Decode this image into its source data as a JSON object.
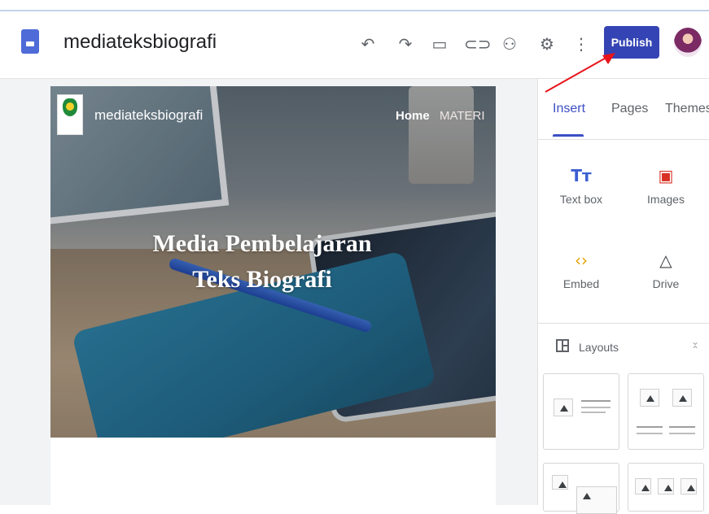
{
  "app": {
    "site_title": "mediateksbiografi",
    "publish_label": "Publish",
    "brand_color": "#3544b4"
  },
  "toolbar": {
    "icons": [
      "undo-icon",
      "redo-icon",
      "preview-icon",
      "link-icon",
      "share-icon",
      "settings-icon",
      "more-vert-icon"
    ]
  },
  "page": {
    "site_name": "mediateksbiografi",
    "nav": [
      "Home",
      "MATERI"
    ],
    "hero_title_line1": "Media Pembelajaran",
    "hero_title_line2": "Teks Biografi"
  },
  "panel": {
    "tabs": [
      "Insert",
      "Pages",
      "Themes"
    ],
    "active_tab": "Insert",
    "tools": [
      {
        "label": "Text box",
        "icon": "text-box-icon"
      },
      {
        "label": "Images",
        "icon": "images-icon"
      },
      {
        "label": "Embed",
        "icon": "embed-icon"
      },
      {
        "label": "Drive",
        "icon": "drive-icon"
      }
    ],
    "layouts_label": "Layouts"
  }
}
